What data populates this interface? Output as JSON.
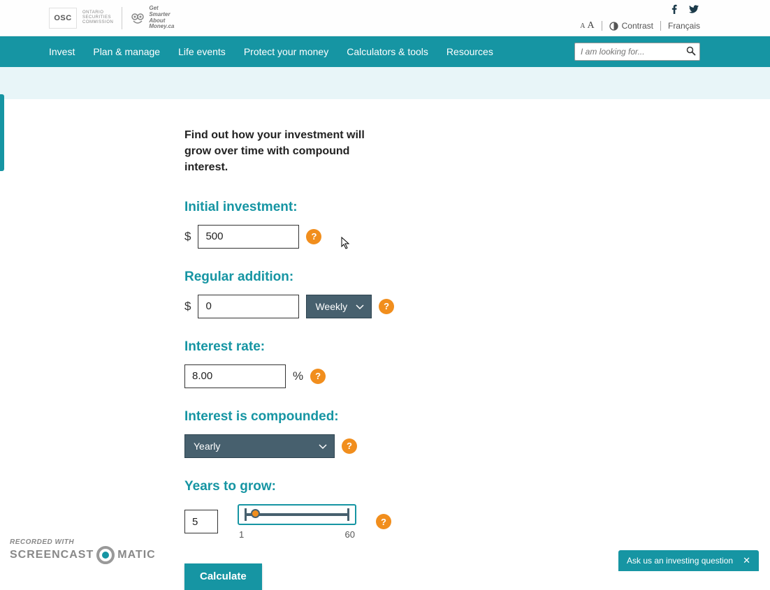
{
  "brand": {
    "osc_box": "OSC",
    "osc_line1": "ONTARIO",
    "osc_line2": "SECURITIES",
    "osc_line3": "COMMISSION",
    "gsam_line1": "Get",
    "gsam_line2": "Smarter",
    "gsam_line3": "About",
    "gsam_line4": "Money.ca"
  },
  "utils": {
    "contrast": "Contrast",
    "language": "Français"
  },
  "nav": {
    "items": [
      "Invest",
      "Plan & manage",
      "Life events",
      "Protect your money",
      "Calculators & tools",
      "Resources"
    ],
    "search_placeholder": "I am looking for..."
  },
  "content": {
    "intro": "Find out how your investment will grow over time with compound interest.",
    "initial": {
      "label": "Initial investment:",
      "currency": "$",
      "value": "500"
    },
    "addition": {
      "label": "Regular addition:",
      "currency": "$",
      "value": "0",
      "frequency": "Weekly"
    },
    "rate": {
      "label": "Interest rate:",
      "value": "8.00",
      "pct": "%"
    },
    "compounded": {
      "label": "Interest is compounded:",
      "value": "Yearly"
    },
    "years": {
      "label": "Years to grow:",
      "value": "5",
      "min": "1",
      "max": "60"
    },
    "help": "?",
    "calculate": "Calculate"
  },
  "watermark": {
    "line1": "RECORDED WITH",
    "part1": "SCREENCAST",
    "part2": "MATIC"
  },
  "ask": {
    "text": "Ask us an investing question",
    "close": "✕"
  }
}
